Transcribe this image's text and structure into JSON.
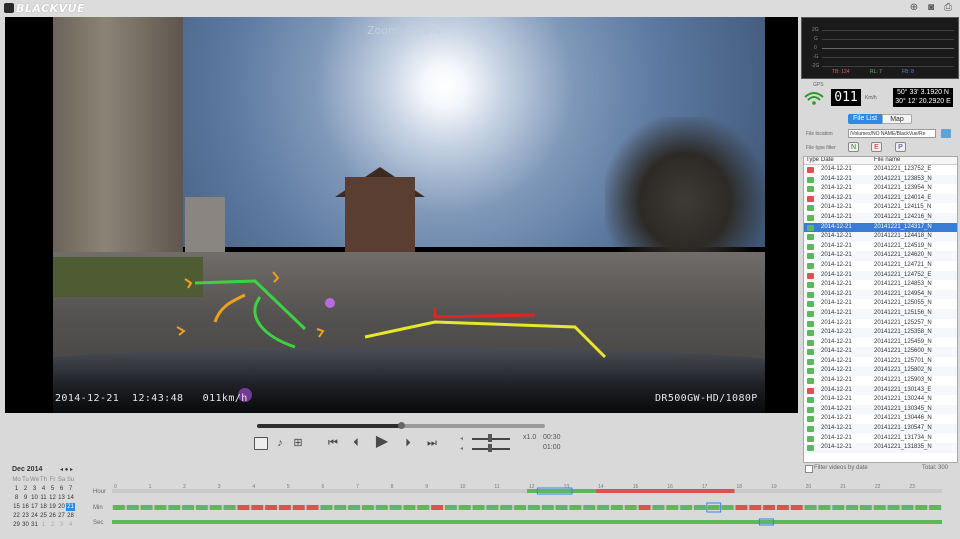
{
  "app": {
    "title": "BLACKVUE"
  },
  "video": {
    "zoom_text": "Zoom: 72.8%",
    "osd_datetime": "2014-12-21  12:43:48   011km/h",
    "osd_model": "DR500GW-HD/1080P"
  },
  "controls": {
    "speed": "x1.0",
    "time_current": "00:30",
    "time_total": "01:00",
    "progress_fraction": 0.5
  },
  "gps": {
    "label": "GPS",
    "speed": "011",
    "unit": "Km/h",
    "lat": "50° 33' 3.1920 N",
    "lon": "30° 12' 20.2920 E"
  },
  "gsensor": {
    "labels": [
      "2G",
      "G",
      "0",
      "-G",
      "-2G"
    ],
    "legend": [
      {
        "text": "TB: 124",
        "color": "#e06060"
      },
      {
        "text": "RL: 7",
        "color": "#60c060"
      },
      {
        "text": "FB: 8",
        "color": "#6080e0"
      }
    ]
  },
  "tabs": {
    "file_list": "File List",
    "map": "Map"
  },
  "file_location": {
    "label": "File location",
    "value": "/Volumes/NO NAME/BlackVue/Re"
  },
  "file_type_filter": {
    "label": "File type filter",
    "buttons": [
      "N",
      "E",
      "P"
    ]
  },
  "files": {
    "headers": {
      "type": "Type",
      "date": "Date",
      "name": "File name"
    },
    "rows": [
      {
        "date": "2014-12-21",
        "name": "20141221_123752_E",
        "kind": "E"
      },
      {
        "date": "2014-12-21",
        "name": "20141221_123853_N",
        "kind": "N"
      },
      {
        "date": "2014-12-21",
        "name": "20141221_123954_N",
        "kind": "N"
      },
      {
        "date": "2014-12-21",
        "name": "20141221_124014_E",
        "kind": "E"
      },
      {
        "date": "2014-12-21",
        "name": "20141221_124115_N",
        "kind": "N"
      },
      {
        "date": "2014-12-21",
        "name": "20141221_124216_N",
        "kind": "N"
      },
      {
        "date": "2014-12-21",
        "name": "20141221_124317_N",
        "kind": "N",
        "selected": true
      },
      {
        "date": "2014-12-21",
        "name": "20141221_124418_N",
        "kind": "N"
      },
      {
        "date": "2014-12-21",
        "name": "20141221_124519_N",
        "kind": "N"
      },
      {
        "date": "2014-12-21",
        "name": "20141221_124620_N",
        "kind": "N"
      },
      {
        "date": "2014-12-21",
        "name": "20141221_124721_N",
        "kind": "N"
      },
      {
        "date": "2014-12-21",
        "name": "20141221_124752_E",
        "kind": "E"
      },
      {
        "date": "2014-12-21",
        "name": "20141221_124853_N",
        "kind": "N"
      },
      {
        "date": "2014-12-21",
        "name": "20141221_124954_N",
        "kind": "N"
      },
      {
        "date": "2014-12-21",
        "name": "20141221_125055_N",
        "kind": "N"
      },
      {
        "date": "2014-12-21",
        "name": "20141221_125156_N",
        "kind": "N"
      },
      {
        "date": "2014-12-21",
        "name": "20141221_125257_N",
        "kind": "N"
      },
      {
        "date": "2014-12-21",
        "name": "20141221_125358_N",
        "kind": "N"
      },
      {
        "date": "2014-12-21",
        "name": "20141221_125459_N",
        "kind": "N"
      },
      {
        "date": "2014-12-21",
        "name": "20141221_125600_N",
        "kind": "N"
      },
      {
        "date": "2014-12-21",
        "name": "20141221_125701_N",
        "kind": "N"
      },
      {
        "date": "2014-12-21",
        "name": "20141221_125802_N",
        "kind": "N"
      },
      {
        "date": "2014-12-21",
        "name": "20141221_125903_N",
        "kind": "N"
      },
      {
        "date": "2014-12-21",
        "name": "20141221_130143_E",
        "kind": "E"
      },
      {
        "date": "2014-12-21",
        "name": "20141221_130244_N",
        "kind": "N"
      },
      {
        "date": "2014-12-21",
        "name": "20141221_130345_N",
        "kind": "N"
      },
      {
        "date": "2014-12-21",
        "name": "20141221_130446_N",
        "kind": "N"
      },
      {
        "date": "2014-12-21",
        "name": "20141221_130547_N",
        "kind": "N"
      },
      {
        "date": "2014-12-21",
        "name": "20141221_131734_N",
        "kind": "N"
      },
      {
        "date": "2014-12-21",
        "name": "20141221_131835_N",
        "kind": "N"
      }
    ],
    "filter_label": "Filter videos by date",
    "total": "Total: 300"
  },
  "calendar": {
    "month": "Dec 2014",
    "weekdays": [
      "Mo",
      "Tu",
      "We",
      "Th",
      "Fr",
      "Sa",
      "Su"
    ],
    "days": [
      "1",
      "2",
      "3",
      "4",
      "5",
      "6",
      "7",
      "8",
      "9",
      "10",
      "11",
      "12",
      "13",
      "14",
      "15",
      "16",
      "17",
      "18",
      "19",
      "20",
      "21",
      "22",
      "23",
      "24",
      "25",
      "26",
      "27",
      "28",
      "29",
      "30",
      "31"
    ],
    "selected_day": "21",
    "trailing": [
      "1",
      "2",
      "3",
      "4"
    ]
  },
  "timeline": {
    "row_labels": [
      "Hour",
      "Min",
      "Sec"
    ],
    "hour_ticks": [
      "0",
      "1",
      "2",
      "3",
      "4",
      "5",
      "6",
      "7",
      "8",
      "9",
      "10",
      "11",
      "12",
      "13",
      "14",
      "15",
      "16",
      "17",
      "18",
      "19",
      "20",
      "21",
      "22",
      "23"
    ]
  },
  "colors": {
    "accent": "#2f8ae5",
    "normal": "#5cb85c",
    "event": "#d9534f"
  }
}
